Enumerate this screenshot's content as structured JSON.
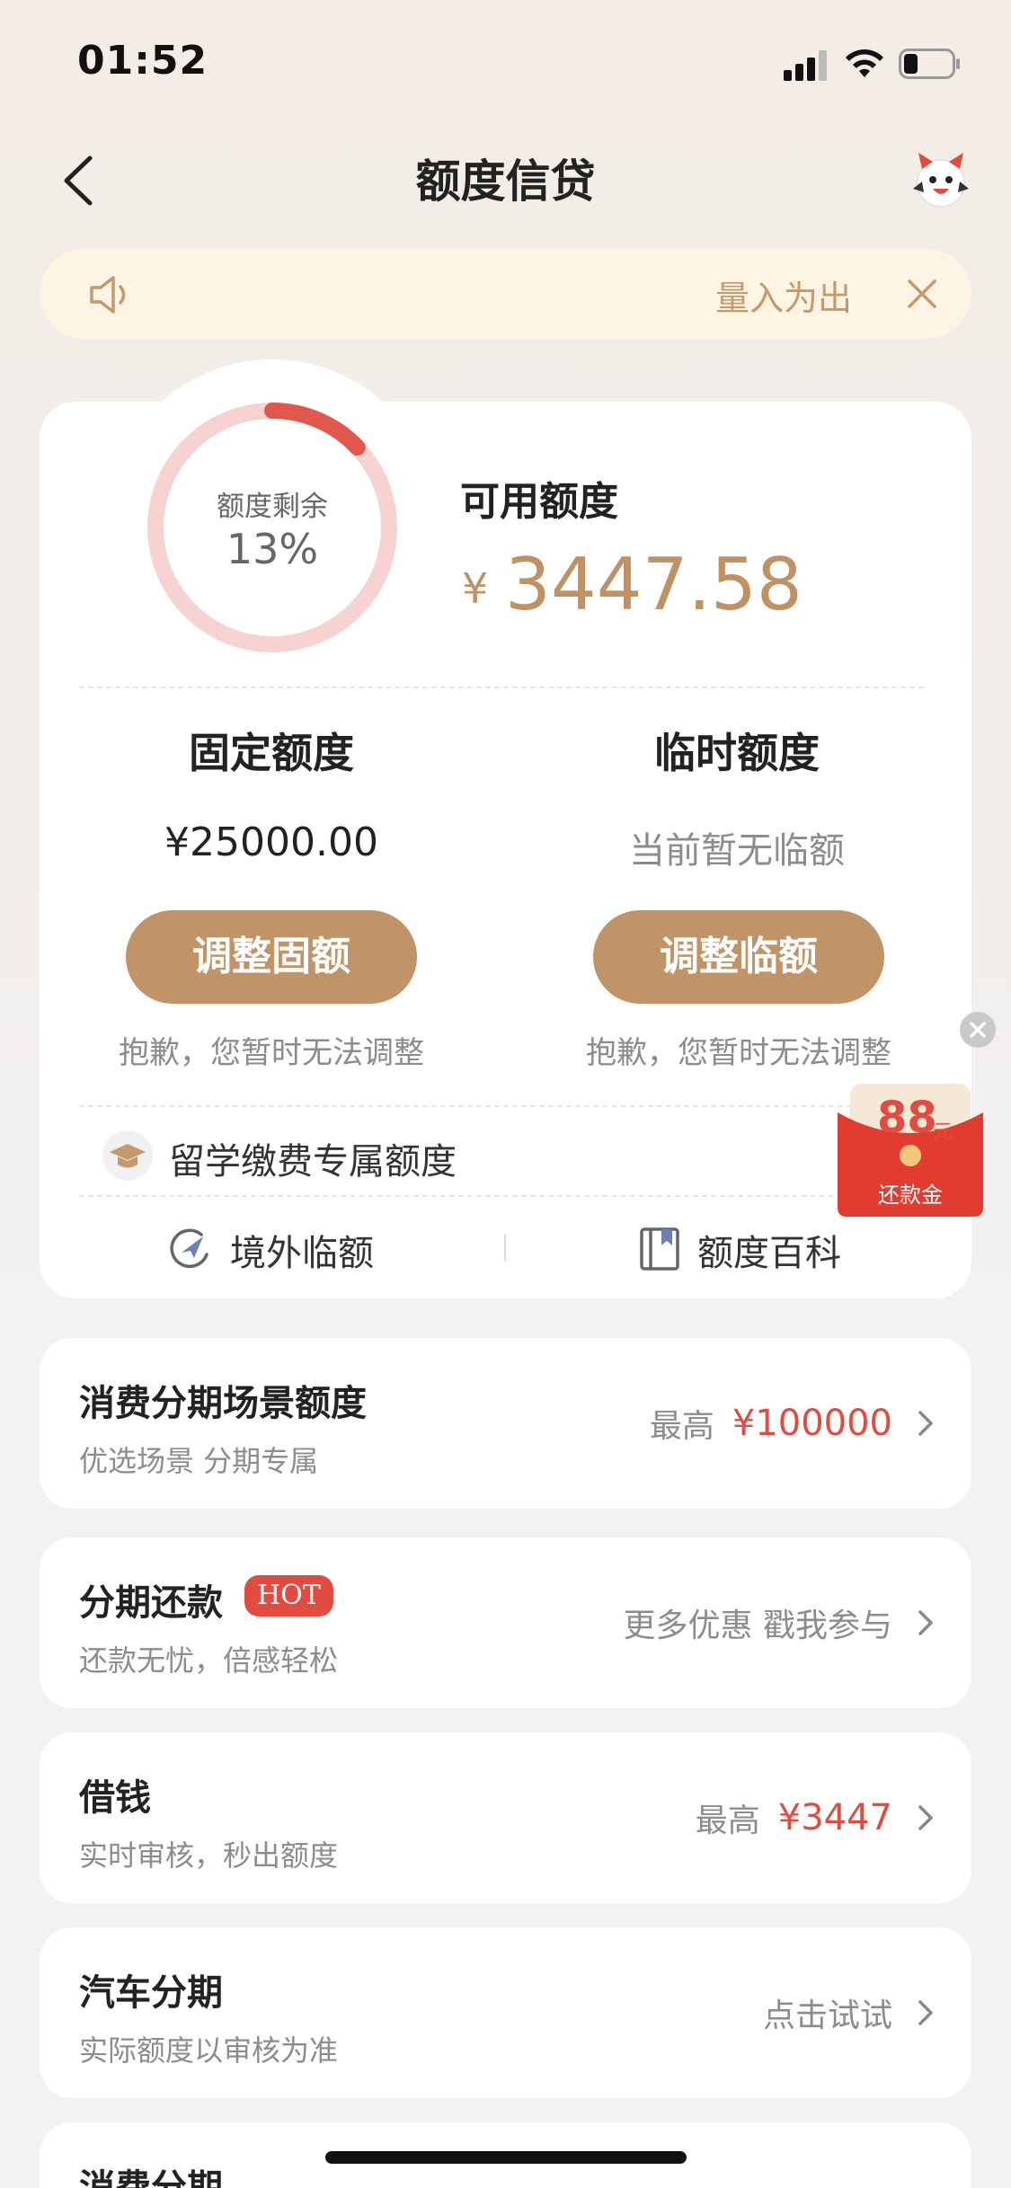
{
  "status_bar": {
    "time": "01:52"
  },
  "nav": {
    "title": "额度信贷"
  },
  "notice": {
    "text": "量入为出"
  },
  "quota": {
    "ring_label": "额度剩余",
    "ring_percent": "13%",
    "remaining_fraction": 0.13,
    "available_label": "可用额度",
    "currency": "¥",
    "available_amount": "3447.58",
    "fixed": {
      "title": "固定额度",
      "value": "¥25000.00",
      "button": "调整固额",
      "note": "抱歉，您暂时无法调整"
    },
    "temporary": {
      "title": "临时额度",
      "value": "当前暂无临额",
      "button": "调整临额",
      "note": "抱歉，您暂时无法调整"
    },
    "study_label": "留学缴费专属额度",
    "links": {
      "overseas": "境外临额",
      "encyclopedia": "额度百科"
    }
  },
  "red_packet": {
    "amount": "88",
    "unit": "元",
    "label": "还款金"
  },
  "list": [
    {
      "title": "消费分期场景额度",
      "subtitle": "优选场景 分期专属",
      "right_label": "最高",
      "right_value": "¥100000"
    },
    {
      "title": "分期还款",
      "badge": "HOT",
      "subtitle": "还款无忧，倍感轻松",
      "right_text": "更多优惠 戳我参与"
    },
    {
      "title": "借钱",
      "subtitle": "实时审核，秒出额度",
      "right_label": "最高",
      "right_value": "¥3447"
    },
    {
      "title": "汽车分期",
      "subtitle": "实际额度以审核为准",
      "right_text": "点击试试"
    },
    {
      "title": "消费分期"
    }
  ],
  "colors": {
    "accent_gold": "#c09467",
    "ring_red": "#e0584c",
    "ring_track": "#f6d2d0",
    "highlight_red": "#e24b3f"
  }
}
